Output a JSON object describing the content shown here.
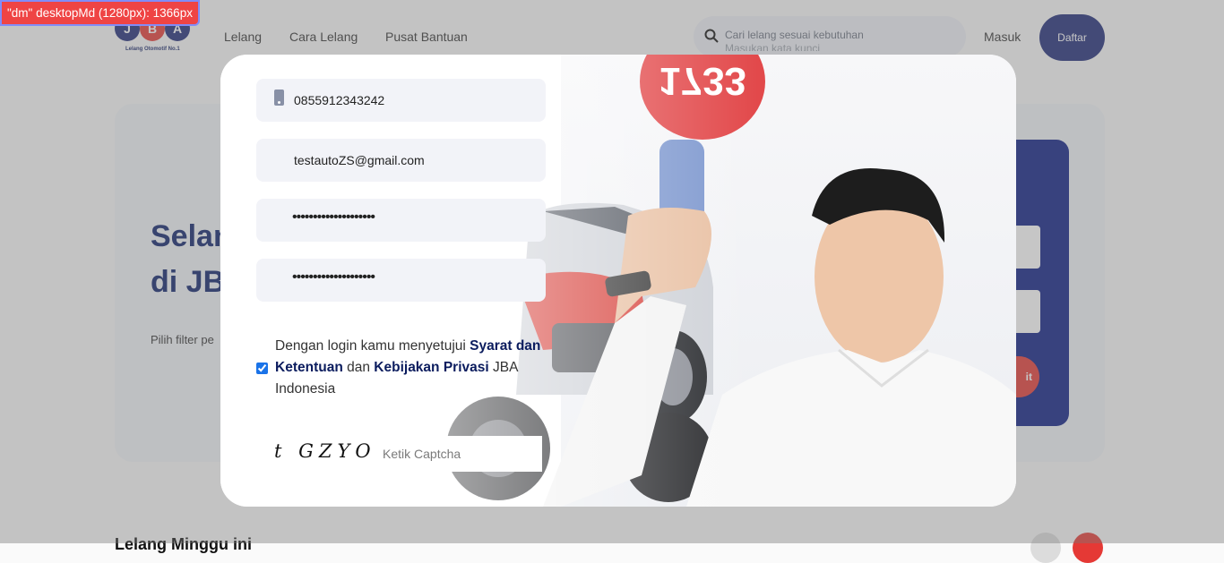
{
  "debug_badge": "\"dm\" desktopMd (1280px): 1366px",
  "logo": {
    "letters": [
      "J",
      "B",
      "A"
    ],
    "tagline": "Lelang Otomotif No.1"
  },
  "nav": [
    "Lelang",
    "Cara Lelang",
    "Pusat Bantuan"
  ],
  "search": {
    "placeholder": "Cari lelang sesuai kebutuhan",
    "placeholder_line2": "Masukan kata kunci"
  },
  "header": {
    "login": "Masuk",
    "register": "Daftar"
  },
  "hero": {
    "title_line1": "Selan",
    "title_line2": "di JB",
    "subtitle": "Pilih filter pe",
    "button_partial": "it"
  },
  "section_title": "Lelang Minggu ini",
  "modal": {
    "phone_value": "0855912343242",
    "email_value": "testautoZS@gmail.com",
    "password_mask": "••••••••••••••••••••",
    "confirm_mask": "••••••••••••••••••••",
    "consent": {
      "prefix": "Dengan login kamu menyetujui",
      "terms": "Syarat dan Ketentuan",
      "and": "dan",
      "privacy": "Kebijakan Privasi",
      "suffix": "JBA Indonesia",
      "checked": true
    },
    "captcha_text": "t GZYOf",
    "captcha_placeholder": "Ketik Captcha",
    "paddle_number": "1733"
  },
  "colors": {
    "primary_navy": "#1e2a78",
    "accent_red": "#e53935",
    "field_bg": "#f2f3f8"
  }
}
